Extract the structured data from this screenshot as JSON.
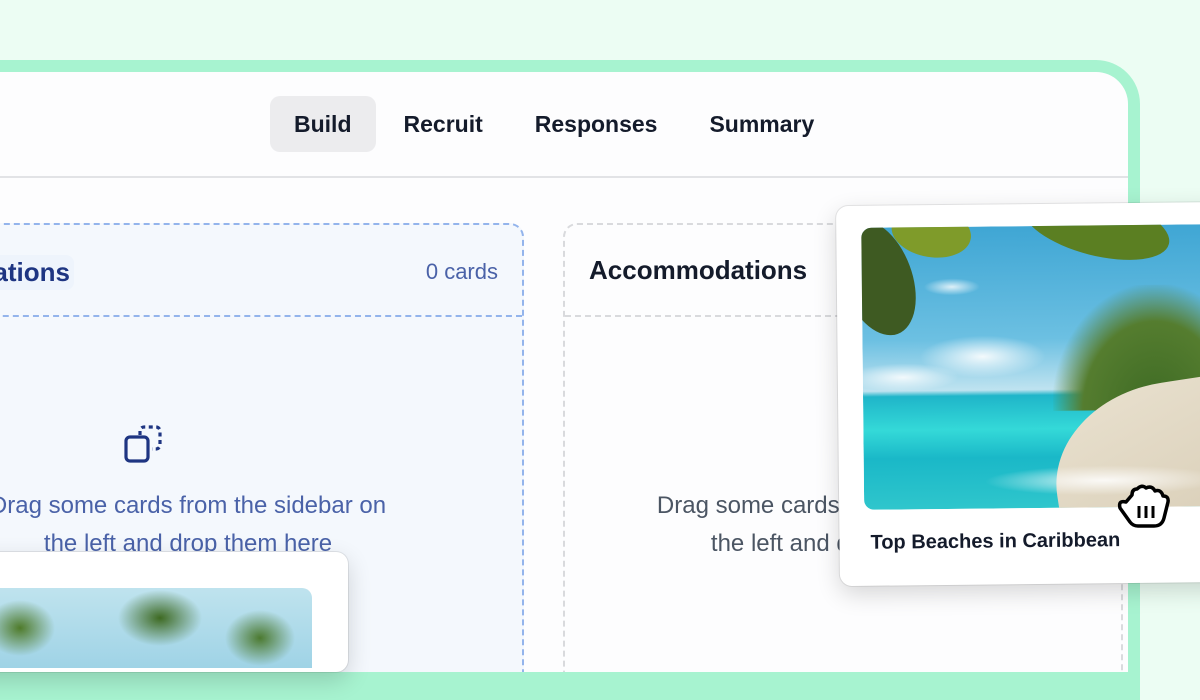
{
  "tabs": [
    {
      "label": "Build",
      "active": true
    },
    {
      "label": "Recruit",
      "active": false
    },
    {
      "label": "Responses",
      "active": false
    },
    {
      "label": "Summary",
      "active": false
    }
  ],
  "columns": [
    {
      "title": "ations",
      "count": "0 cards",
      "empty_text": "Drag some cards from the sidebar on the left and drop them here",
      "state": "drop-target-active"
    },
    {
      "title": "Accommodations",
      "empty_text": "Drag some cards from the sidebar on the left and drop them here",
      "state": "idle"
    }
  ],
  "dragged_card": {
    "title": "Top Beaches in Caribbean",
    "image": "tropical-beach-photo"
  },
  "other_card": {
    "image": "palm-trees-photo"
  },
  "cursor": "grab-hand-cursor",
  "colors": {
    "background": "#ecfdf3",
    "frame_border": "#a7f3d0",
    "active_column_border": "#93b4ec",
    "active_text": "#1e3582",
    "tab_active_bg": "#ececee"
  }
}
